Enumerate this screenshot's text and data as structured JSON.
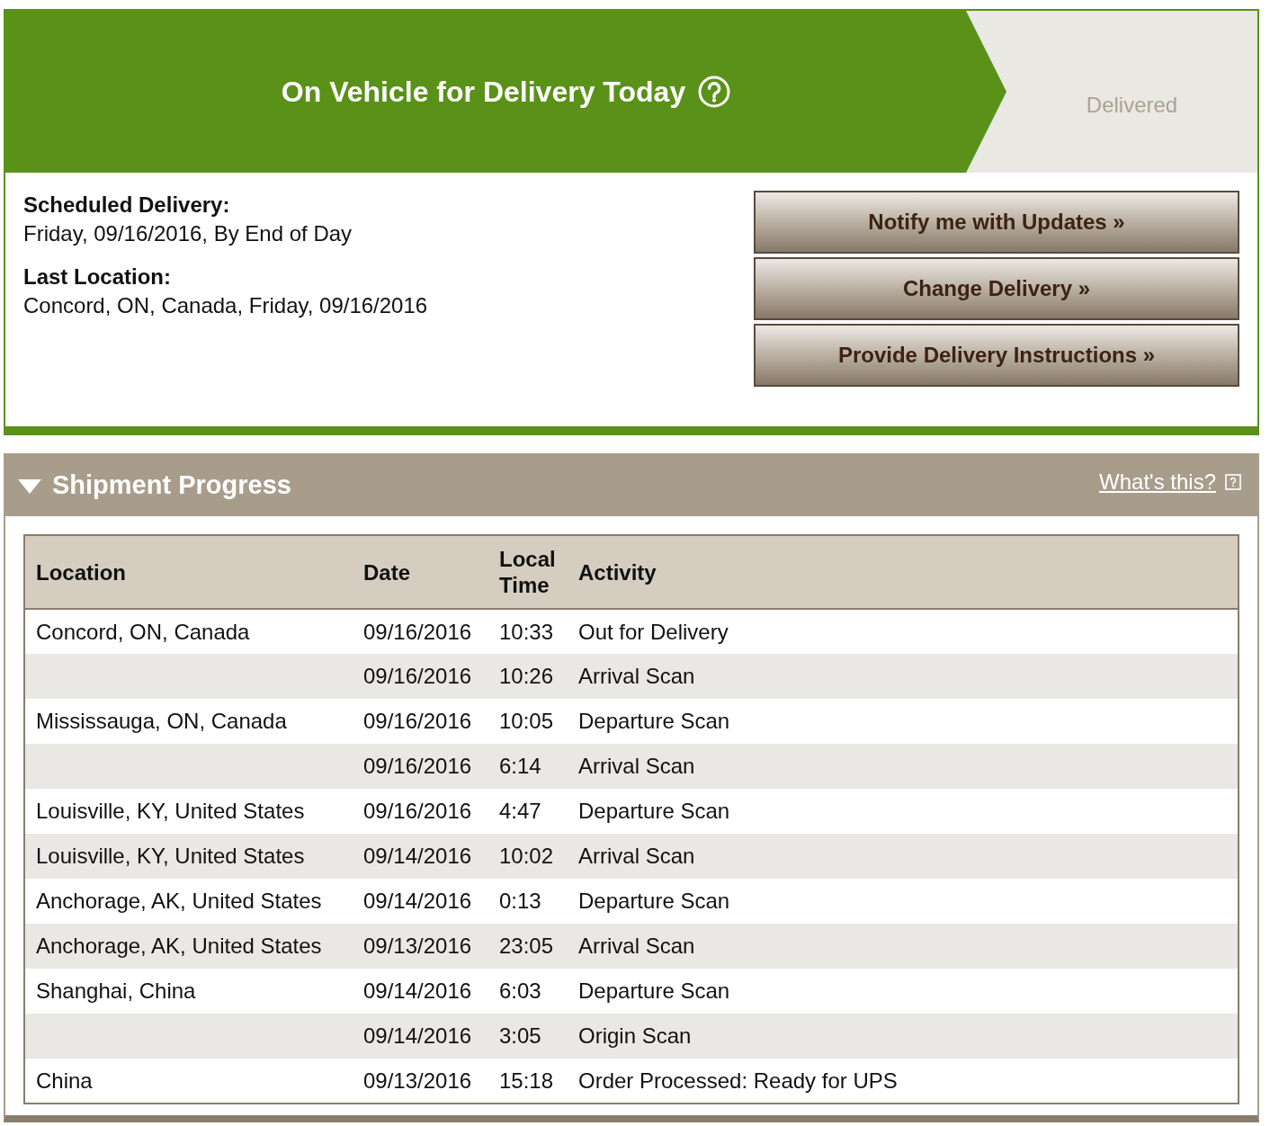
{
  "status_banner": {
    "steps": [
      {
        "label": "On Vehicle for Delivery Today",
        "active": true,
        "help": true
      },
      {
        "label": "Delivered",
        "active": false,
        "help": false
      }
    ]
  },
  "delivery_info": [
    {
      "label": "Scheduled Delivery:",
      "value": "Friday, 09/16/2016, By End of Day"
    },
    {
      "label": "Last Location:",
      "value": "Concord, ON, Canada, Friday, 09/16/2016"
    }
  ],
  "actions": [
    "Notify me with Updates »",
    "Change Delivery »",
    "Provide Delivery Instructions »"
  ],
  "shipment_progress": {
    "title": "Shipment Progress",
    "expanded": true,
    "help_link": "What's this?",
    "table": {
      "columns": [
        "Location",
        "Date",
        "Local Time",
        "Activity"
      ],
      "rows": [
        {
          "location": "Concord, ON, Canada",
          "date": "09/16/2016",
          "time": "10:33",
          "activity": "Out for Delivery"
        },
        {
          "date": "09/16/2016",
          "time": "10:26",
          "activity": "Arrival Scan"
        },
        {
          "location": "Mississauga, ON, Canada",
          "date": "09/16/2016",
          "time": "10:05",
          "activity": "Departure Scan"
        },
        {
          "date": "09/16/2016",
          "time": "6:14",
          "activity": "Arrival Scan"
        },
        {
          "location": "Louisville, KY, United States",
          "date": "09/16/2016",
          "time": "4:47",
          "activity": "Departure Scan"
        },
        {
          "location": "Louisville, KY, United States",
          "date": "09/14/2016",
          "time": "10:02",
          "activity": "Arrival Scan"
        },
        {
          "location": "Anchorage, AK, United States",
          "date": "09/14/2016",
          "time": "0:13",
          "activity": "Departure Scan"
        },
        {
          "location": "Anchorage, AK, United States",
          "date": "09/13/2016",
          "time": "23:05",
          "activity": "Arrival Scan"
        },
        {
          "location": "Shanghai, China",
          "date": "09/14/2016",
          "time": "6:03",
          "activity": "Departure Scan"
        },
        {
          "date": "09/14/2016",
          "time": "3:05",
          "activity": "Origin Scan"
        },
        {
          "location": "China",
          "date": "09/13/2016",
          "time": "15:18",
          "activity": "Order Processed: Ready for UPS"
        }
      ]
    }
  }
}
